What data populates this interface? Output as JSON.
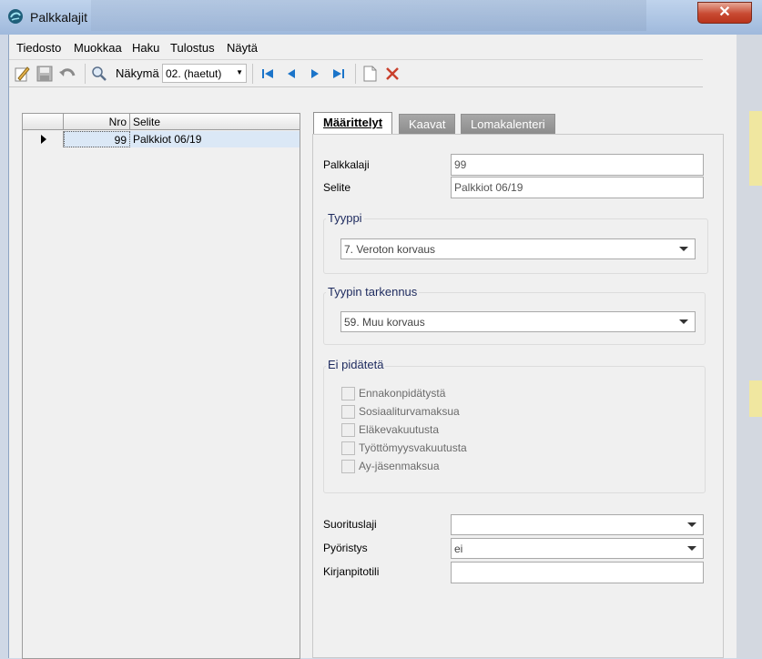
{
  "window": {
    "title": "Palkkalajit",
    "close_label": "✕"
  },
  "menu": [
    {
      "label": "Tiedosto",
      "name": "menu-tiedosto"
    },
    {
      "label": "Muokkaa",
      "name": "menu-muokkaa"
    },
    {
      "label": "Haku",
      "name": "menu-haku"
    },
    {
      "label": "Tulostus",
      "name": "menu-tulostus"
    },
    {
      "label": "Näytä",
      "name": "menu-nayta"
    }
  ],
  "toolbar": {
    "view_label": "Näkymä",
    "view_value": "02. (haetut)"
  },
  "grid": {
    "headers": {
      "nro": "Nro",
      "selite": "Selite"
    },
    "rows": [
      {
        "nro": "99",
        "selite": "Palkkiot 06/19"
      }
    ]
  },
  "tabs": [
    {
      "label": "Määrittelyt",
      "active": true
    },
    {
      "label": "Kaavat",
      "active": false
    },
    {
      "label": "Lomakalenteri",
      "active": false
    }
  ],
  "form": {
    "palkkalaji_label": "Palkkalaji",
    "palkkalaji_value": "99",
    "selite_label": "Selite",
    "selite_value": "Palkkiot 06/19",
    "tyyppi_title": "Tyyppi",
    "tyyppi_value": "7. Veroton korvaus",
    "tarkennus_title": "Tyypin tarkennus",
    "tarkennus_value": "59. Muu korvaus",
    "ei_pidateta_title": "Ei pidätetä",
    "checks": [
      "Ennakonpidätystä",
      "Sosiaaliturvamaksua",
      "Eläkevakuutusta",
      "Työttömyysvakuutusta",
      "Ay-jäsenmaksua"
    ],
    "suorituslaji_label": "Suorituslaji",
    "suorituslaji_value": "",
    "pyoristys_label": "Pyöristys",
    "pyoristys_value": "ei",
    "kirjanpitotili_label": "Kirjanpitotili",
    "kirjanpitotili_value": ""
  },
  "colors": {
    "selection": "#dbe8f6",
    "close": "#c84a32",
    "group_title": "#1d2a5e"
  }
}
